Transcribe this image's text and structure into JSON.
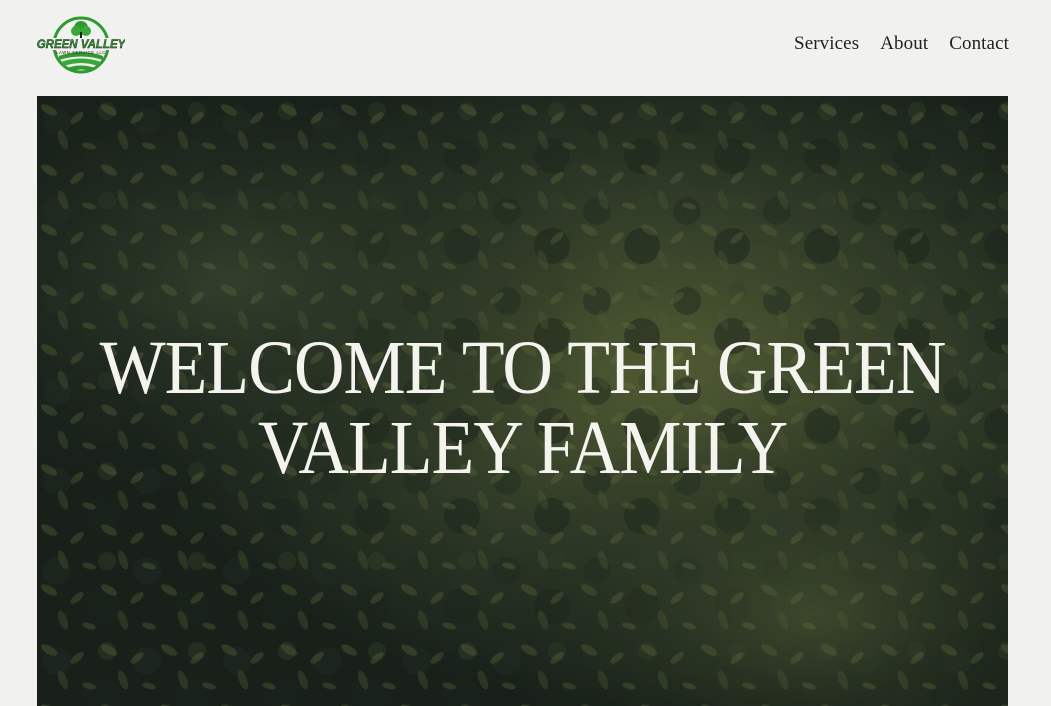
{
  "header": {
    "logo": {
      "icon": "green-valley-logo-icon",
      "wordmark": "GREEN VALLEY",
      "tagline": "LAWN SERVICE LLC",
      "colors": {
        "green": "#2f9a2f",
        "dark": "#1c1c1c"
      }
    },
    "nav": [
      {
        "label": "Services"
      },
      {
        "label": "About"
      },
      {
        "label": "Contact"
      }
    ]
  },
  "hero": {
    "title": "WELCOME TO THE GREEN VALLEY FAMILY",
    "background": "aerial-forest-canopy-image",
    "colors": {
      "text": "#f4f3ee",
      "canopy_dark": "#1a241c",
      "canopy_light": "#6e7a45"
    }
  },
  "colors": {
    "page_background": "#f1f1ef",
    "nav_text": "#222222"
  }
}
